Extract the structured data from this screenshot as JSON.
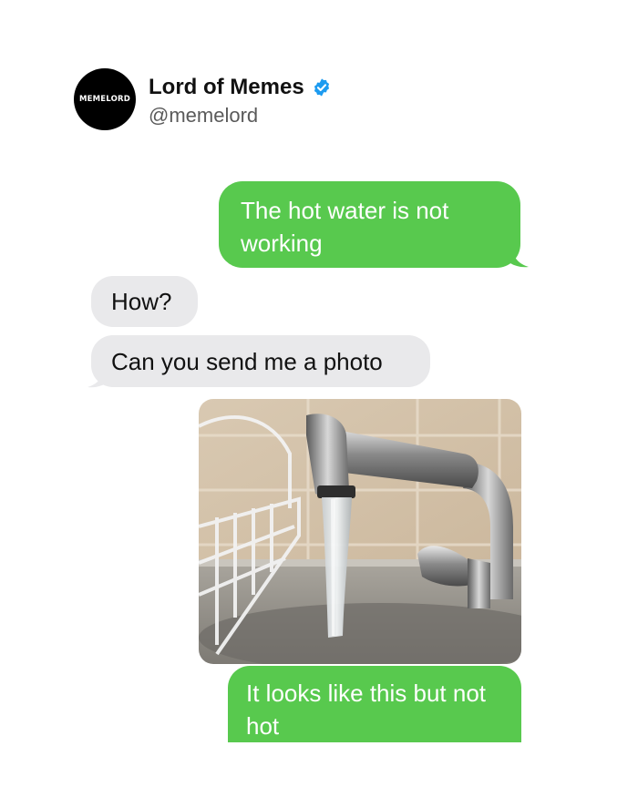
{
  "header": {
    "avatar_text": "MEMELORD",
    "display_name": "Lord of Memes",
    "handle": "@memelord",
    "verified_icon": "verified-badge-icon",
    "verified_color": "#1d9bf0"
  },
  "messages": [
    {
      "side": "sent",
      "text": "The hot water is not working"
    },
    {
      "side": "received",
      "text": "How?"
    },
    {
      "side": "received",
      "text": "Can you send me a photo"
    },
    {
      "side": "sent",
      "type": "photo",
      "text": ""
    },
    {
      "side": "sent",
      "text": "It looks like this but not hot"
    }
  ],
  "colors": {
    "sent_bubble": "#58c94e",
    "received_bubble": "#e9e9eb",
    "background": "#ffffff"
  }
}
